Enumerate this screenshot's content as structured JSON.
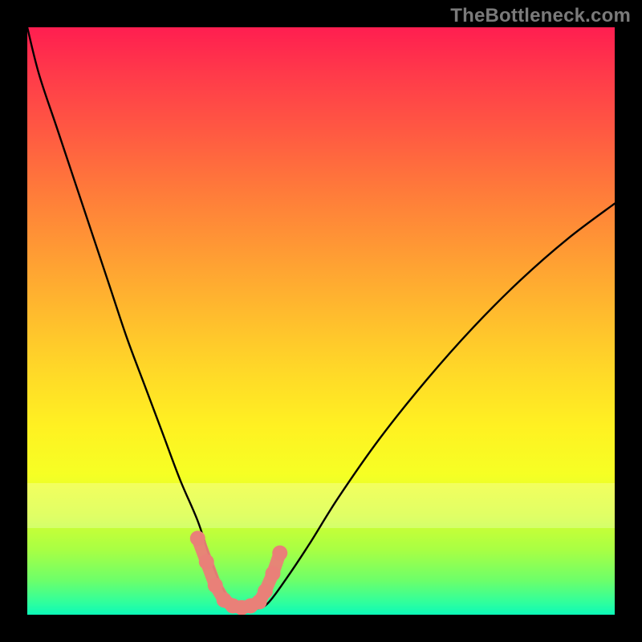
{
  "watermark": "TheBottleneck.com",
  "colors": {
    "frame": "#000000",
    "gradient_top": "#ff1e50",
    "gradient_bottom": "#0cf9b8",
    "pale_band": "rgba(255,255,255,0.26)",
    "curve": "#000000",
    "marker_fill": "#e98078",
    "marker_stroke": "#d5574f"
  },
  "chart_data": {
    "type": "line",
    "title": "",
    "xlabel": "",
    "ylabel": "",
    "xlim": [
      0,
      100
    ],
    "ylim": [
      0,
      100
    ],
    "grid": false,
    "legend": false,
    "note": "V-shaped bottleneck curve. Approximate percentage values read from the gradient (top≈100%, bottom≈0%). Minimum plateau ≈0% near x≈33–41; right branch rises toward ≈70% at x=100.",
    "series": [
      {
        "name": "bottleneck-curve",
        "x": [
          0,
          2,
          5,
          8,
          11,
          14,
          17,
          20,
          23,
          26,
          29,
          31,
          33,
          35,
          37,
          39,
          41,
          44,
          48,
          53,
          60,
          68,
          76,
          84,
          92,
          100
        ],
        "values": [
          100,
          92,
          83,
          74,
          65,
          56,
          47,
          39,
          31,
          23,
          16,
          10,
          5,
          2,
          1,
          1,
          2,
          6,
          12,
          20,
          30,
          40,
          49,
          57,
          64,
          70
        ]
      }
    ],
    "markers": {
      "name": "highlighted-points",
      "x": [
        29.0,
        30.5,
        32.0,
        33.5,
        35.0,
        36.5,
        38.0,
        39.5,
        40.5,
        41.8,
        43.0
      ],
      "values": [
        13.0,
        9.0,
        5.0,
        2.5,
        1.5,
        1.2,
        1.5,
        2.2,
        4.0,
        7.0,
        10.5
      ]
    }
  }
}
